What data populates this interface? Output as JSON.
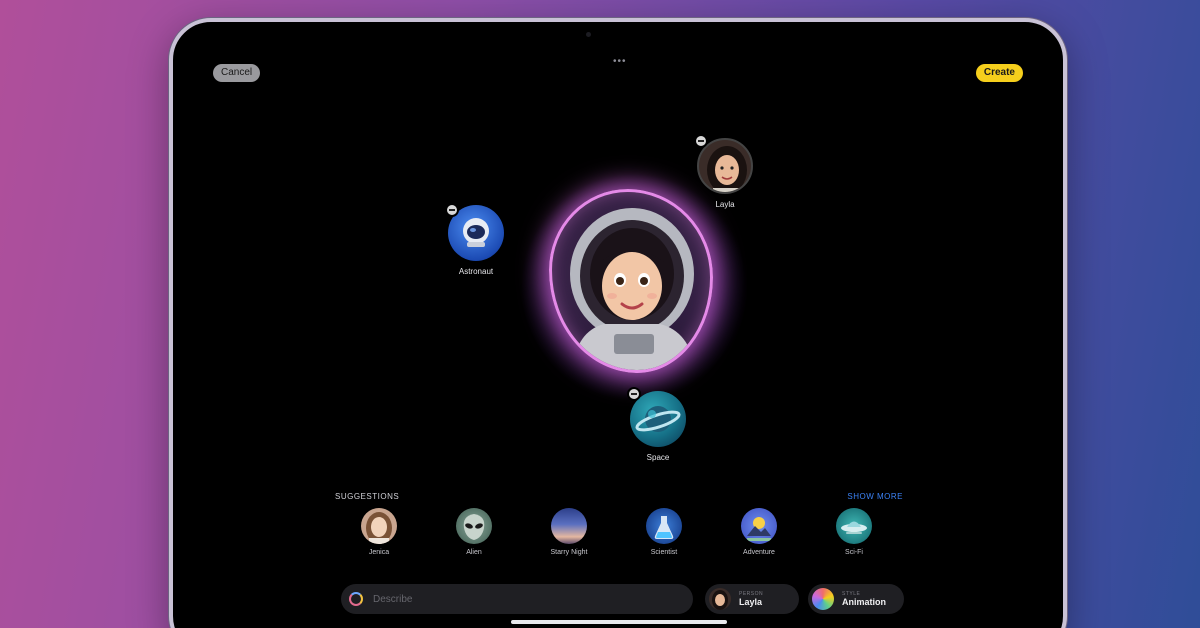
{
  "toolbar": {
    "cancel_label": "Cancel",
    "create_label": "Create"
  },
  "concepts": [
    {
      "label": "Layla"
    },
    {
      "label": "Astronaut"
    },
    {
      "label": "Space"
    }
  ],
  "suggestions": {
    "title": "SUGGESTIONS",
    "show_more": "SHOW MORE",
    "items": [
      {
        "label": "Jenica"
      },
      {
        "label": "Alien"
      },
      {
        "label": "Starry Night"
      },
      {
        "label": "Scientist"
      },
      {
        "label": "Adventure"
      },
      {
        "label": "Sci-Fi"
      }
    ]
  },
  "input": {
    "placeholder": "Describe"
  },
  "person": {
    "caption": "PERSON",
    "value": "Layla"
  },
  "style": {
    "caption": "STYLE",
    "value": "Animation"
  },
  "colors": {
    "accent_create": "#f6cf1c",
    "glow": "#e58ae8",
    "link": "#3b82f6"
  }
}
